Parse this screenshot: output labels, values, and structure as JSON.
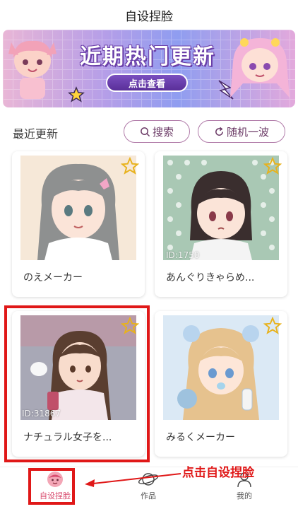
{
  "header": {
    "title": "自设捏脸"
  },
  "banner": {
    "headline": "近期热门更新",
    "cta": "点击查看"
  },
  "section": {
    "title": "最近更新",
    "search_label": "搜索",
    "random_label": "随机一波"
  },
  "cards": [
    {
      "name": "のえメーカー",
      "id_text": ""
    },
    {
      "name": "あんぐりきゃらめ...",
      "id_text": "ID:1750"
    },
    {
      "name": "ナチュラル女子を...",
      "id_text": "ID:31867"
    },
    {
      "name": "みるくメーカー",
      "id_text": ""
    }
  ],
  "tabbar": {
    "tabs": [
      {
        "label": "自设捏脸",
        "icon": "face-icon",
        "active": true
      },
      {
        "label": "作品",
        "icon": "planet-icon",
        "active": false
      },
      {
        "label": "我的",
        "icon": "user-icon",
        "active": false
      }
    ]
  },
  "annotation": {
    "text": "点击自设捏脸"
  },
  "colors": {
    "accent": "#d84b6e",
    "highlight": "#e01818",
    "pill_border": "#b07aa8"
  }
}
